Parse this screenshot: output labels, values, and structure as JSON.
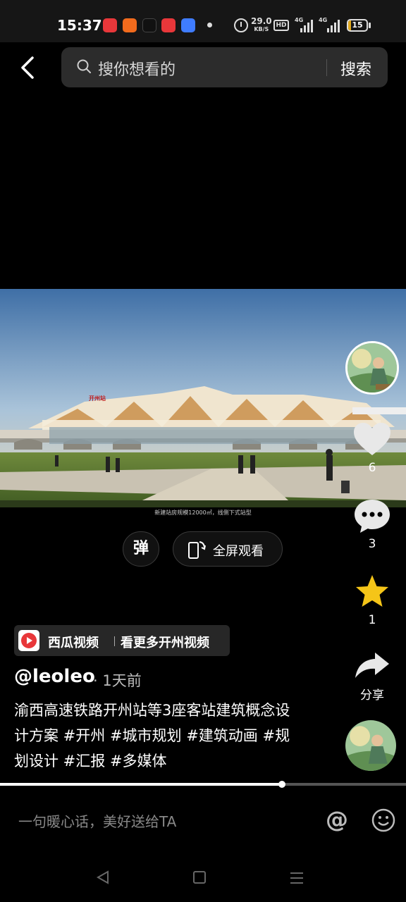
{
  "status_bar": {
    "time": "15:37",
    "net_speed_value": "29.0",
    "net_speed_unit": "KB/S",
    "hd_label": "HD",
    "network_1": "4G",
    "network_2": "4G",
    "battery_level": "15",
    "battery_fraction": 0.15,
    "notification_icons": [
      "pinduoduo-icon",
      "fox-app-icon",
      "tiktok-icon",
      "toutiao-icon",
      "qq-icon"
    ]
  },
  "header": {
    "search_placeholder": "搜你想看的",
    "search_button": "搜索"
  },
  "video": {
    "station_sign": "开州站",
    "caption": "新建站房规模12000㎡，线侧下式站型",
    "danmaku_label": "弹",
    "fullscreen_label": "全屏观看",
    "progress": 0.695
  },
  "right_rail": {
    "like_count": "6",
    "comment_count": "3",
    "favorite_count": "1",
    "share_label": "分享"
  },
  "source": {
    "name": "西瓜视频",
    "more": "看更多开州视频"
  },
  "post": {
    "author": "@leoleo",
    "time": "· 1天前",
    "description": "渝西高速铁路开州站等3座客站建筑概念设计方案 #开州 #城市规划 #建筑动画 #规划设计 #汇报 #多媒体"
  },
  "comment_bar": {
    "placeholder": "一句暖心话，美好送给TA",
    "at_symbol": "@"
  },
  "colors": {
    "favorite": "#f5c518",
    "background": "#000000",
    "search_bg": "#2c2c2c",
    "battery": "#e0a81c"
  }
}
